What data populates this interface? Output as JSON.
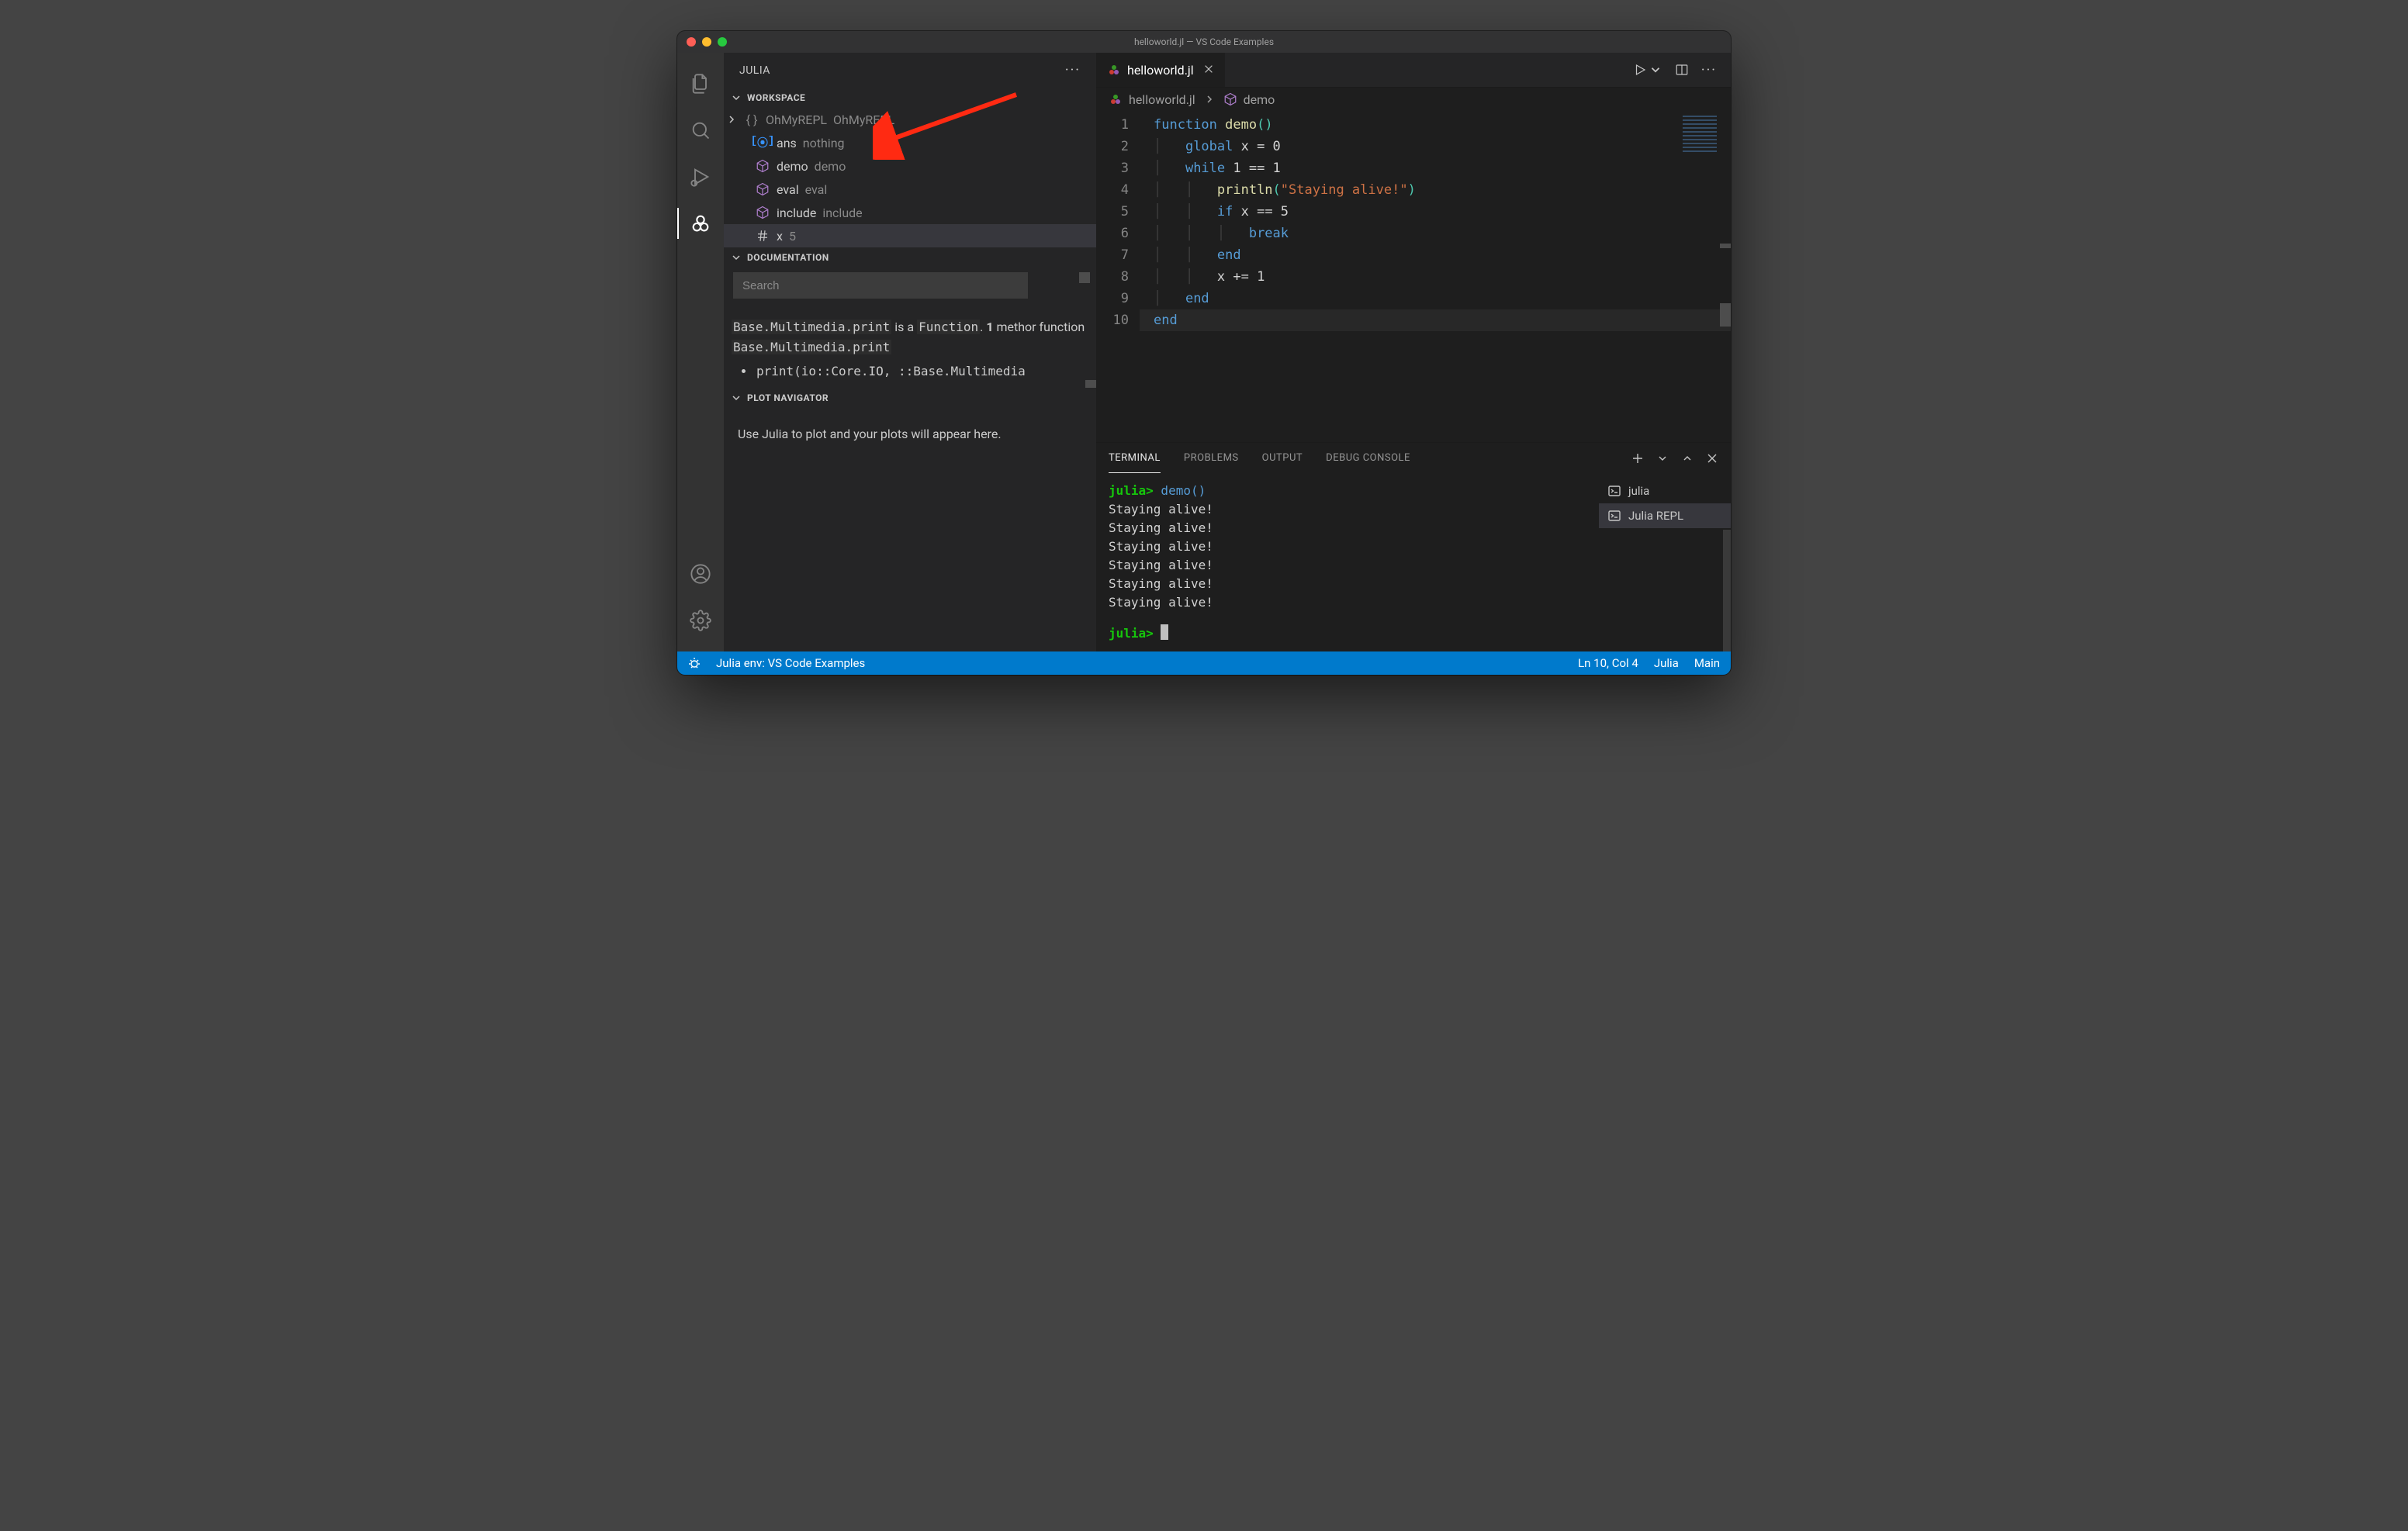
{
  "titlebar": {
    "title": "helloworld.jl — VS Code Examples"
  },
  "sidebar": {
    "title": "JULIA",
    "sections": {
      "workspace": {
        "label": "WORKSPACE",
        "items": [
          {
            "name": "OhMyREPL",
            "type": "OhMyREPL"
          },
          {
            "name": "ans",
            "type": "nothing"
          },
          {
            "name": "demo",
            "type": "demo"
          },
          {
            "name": "eval",
            "type": "eval"
          },
          {
            "name": "include",
            "type": "include"
          },
          {
            "name": "x",
            "type": "5"
          }
        ]
      },
      "documentation": {
        "label": "DOCUMENTATION",
        "search_placeholder": "Search",
        "body_prefix": "Base.Multimedia.print",
        "body_mid": " is a ",
        "body_kind": "Function",
        "body_suffix1": ". ",
        "body_count": "1",
        "body_suffix2": " meth­or function ",
        "body_repeat": "Base.Multimedia.print",
        "sig": "print(io::Core.IO, ::Base.Multimedia"
      },
      "plotnav": {
        "label": "PLOT NAVIGATOR",
        "text": "Use Julia to plot and your plots will appear here."
      }
    }
  },
  "tabs": {
    "active": {
      "label": "helloworld.jl"
    }
  },
  "breadcrumbs": {
    "file": "helloworld.jl",
    "symbol": "demo"
  },
  "editor": {
    "lines": [
      {
        "n": "1"
      },
      {
        "n": "2"
      },
      {
        "n": "3"
      },
      {
        "n": "4"
      },
      {
        "n": "5"
      },
      {
        "n": "6"
      },
      {
        "n": "7"
      },
      {
        "n": "8"
      },
      {
        "n": "9"
      },
      {
        "n": "10"
      }
    ],
    "code": {
      "l1_kw": "function",
      "l1_fn": "demo",
      "l1_paren": "()",
      "l2_kw": "global",
      "l2_rest": " x = 0",
      "l3_kw": "while",
      "l3_rest": " 1 == 1",
      "l4_fn": "println",
      "l4_open": "(",
      "l4_str": "\"Staying alive!\"",
      "l4_close": ")",
      "l5_kw": "if",
      "l5_rest": " x == 5",
      "l6_kw": "break",
      "l7_kw": "end",
      "l8_rest": "x += 1",
      "l9_kw": "end",
      "l10_kw": "end"
    }
  },
  "panel": {
    "tabs": {
      "terminal": "TERMINAL",
      "problems": "PROBLEMS",
      "output": "OUTPUT",
      "debug": "DEBUG CONSOLE"
    },
    "terminals": [
      {
        "label": "julia"
      },
      {
        "label": "Julia REPL"
      }
    ],
    "terminal_content": {
      "prompt": "julia>",
      "call": " demo()",
      "out_line": "Staying alive!",
      "out_count": 6
    }
  },
  "status": {
    "env": "Julia env: VS Code Examples",
    "cursor": "Ln 10, Col 4",
    "lang": "Julia",
    "branch": "Main"
  }
}
